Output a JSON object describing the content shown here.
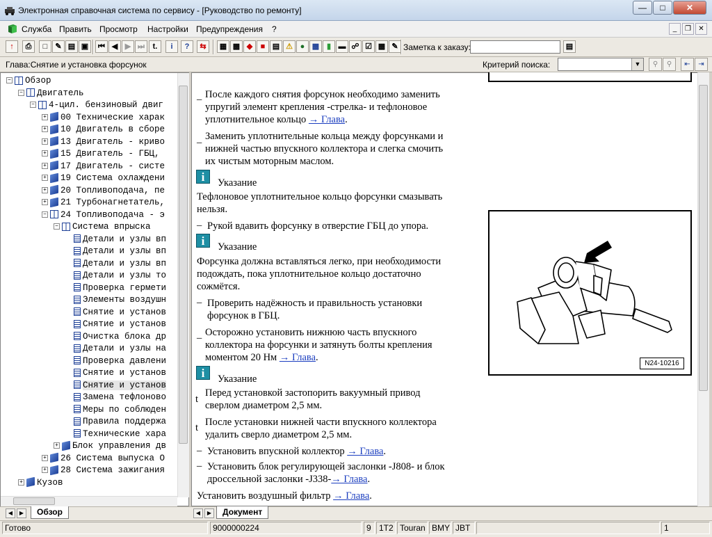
{
  "window": {
    "title": "Электронная справочная система по сервису - [Руководство по ремонту]"
  },
  "menu": {
    "items": [
      "Служба",
      "Править",
      "Просмотр",
      "Настройки",
      "Предупреждения",
      "?"
    ]
  },
  "toolbar": {
    "order_label": "Заметка к заказу:",
    "order_value": ""
  },
  "chapter": {
    "label": "Глава:Снятие и установка форсунок"
  },
  "search": {
    "criteria_label": "Критерий  поиска:",
    "criteria_value": ""
  },
  "tree": {
    "items": [
      {
        "label": "Обзор",
        "icon": "open"
      },
      {
        "label": "Двигатель",
        "icon": "open"
      },
      {
        "label": "4-цил. бензиновый двиг",
        "icon": "open"
      },
      {
        "label": "00 Технические харак",
        "icon": "book"
      },
      {
        "label": "10 Двигатель в сборе",
        "icon": "book"
      },
      {
        "label": "13 Двигатель - криво",
        "icon": "book"
      },
      {
        "label": "15 Двигатель - ГБЦ,",
        "icon": "book"
      },
      {
        "label": "17 Двигатель - систе",
        "icon": "book"
      },
      {
        "label": "19 Система охлаждени",
        "icon": "book"
      },
      {
        "label": "20 Топливоподача, пе",
        "icon": "book"
      },
      {
        "label": "21 Турбонагнетатель,",
        "icon": "book"
      },
      {
        "label": "24 Топливоподача - э",
        "icon": "open"
      },
      {
        "label": "Система впрыска",
        "icon": "open"
      },
      {
        "label": "Детали и узлы вп",
        "icon": "page"
      },
      {
        "label": "Детали и узлы вп",
        "icon": "page"
      },
      {
        "label": "Детали и узлы вп",
        "icon": "page"
      },
      {
        "label": "Детали и узлы то",
        "icon": "page"
      },
      {
        "label": "Проверка гермети",
        "icon": "page"
      },
      {
        "label": "Элементы воздушн",
        "icon": "page"
      },
      {
        "label": "Снятие и установ",
        "icon": "page"
      },
      {
        "label": "Снятие и установ",
        "icon": "page"
      },
      {
        "label": "Очистка блока др",
        "icon": "page"
      },
      {
        "label": "Детали и узлы на",
        "icon": "page"
      },
      {
        "label": "Проверка давлени",
        "icon": "page"
      },
      {
        "label": "Снятие и установ",
        "icon": "page"
      },
      {
        "label": "Снятие и установ",
        "icon": "page"
      },
      {
        "label": "Замена тефлоново",
        "icon": "page"
      },
      {
        "label": "Меры по соблюден",
        "icon": "page"
      },
      {
        "label": "Правила поддержа",
        "icon": "page"
      },
      {
        "label": "Технические хара",
        "icon": "page"
      },
      {
        "label": "Блок управления дв",
        "icon": "book"
      },
      {
        "label": "26 Система выпуска О",
        "icon": "book"
      },
      {
        "label": "28 Система зажигания",
        "icon": "book"
      },
      {
        "label": "Кузов",
        "icon": "book"
      }
    ]
  },
  "doc": {
    "p1": [
      "После каждого снятия форсунок необходимо заменить",
      "упругий элемент крепления -стрелка- и тефлоновое",
      "уплотнительное кольцо "
    ],
    "p2": [
      "Заменить уплотнительные кольца между форсунками и",
      "нижней частью впускного коллектора и слегка смочить",
      "их чистым моторным маслом."
    ],
    "note_label": "Указание",
    "n1": [
      "Тефлоновое уплотнительное кольцо форсунки смазывать",
      "нельзя."
    ],
    "p3": "Рукой вдавить форсунку в отверстие ГБЦ до упора.",
    "n2": [
      "Форсунка должна вставляться легко, при необходимости",
      "подождать, пока уплотнительное кольцо достаточно",
      "сожмётся."
    ],
    "p4": [
      "Проверить надёжность и правильность установки",
      "форсунок в ГБЦ."
    ],
    "p5": [
      "Осторожно установить нижнюю часть впускного",
      "коллектора на форсунки и затянуть болты крепления",
      "моментом 20 Нм "
    ],
    "n3a": [
      "Перед установкой застопорить вакуумный привод",
      "сверлом диаметром 2,5 мм."
    ],
    "n3b": [
      "После установки нижней части впускного коллектора",
      "удалить сверло диаметром 2,5 мм."
    ],
    "p6": "Установить впускной коллектор ",
    "p7": [
      "Установить блок регулирующей заслонки -J808- и блок",
      "дроссельной заслонки -J338-"
    ],
    "p8": "Установить воздушный фильтр ",
    "link": "→ Глава",
    "dash": "–",
    "tmark": "t",
    "figure_code": "N24-10216"
  },
  "tabs": {
    "left": "Обзор",
    "right": "Документ"
  },
  "status": {
    "ready": "Готово",
    "order": "9000000224",
    "s1": "9",
    "s2": "1T2",
    "s3": "Touran",
    "s4": "BMY",
    "s5": "JBT",
    "page": "1"
  }
}
